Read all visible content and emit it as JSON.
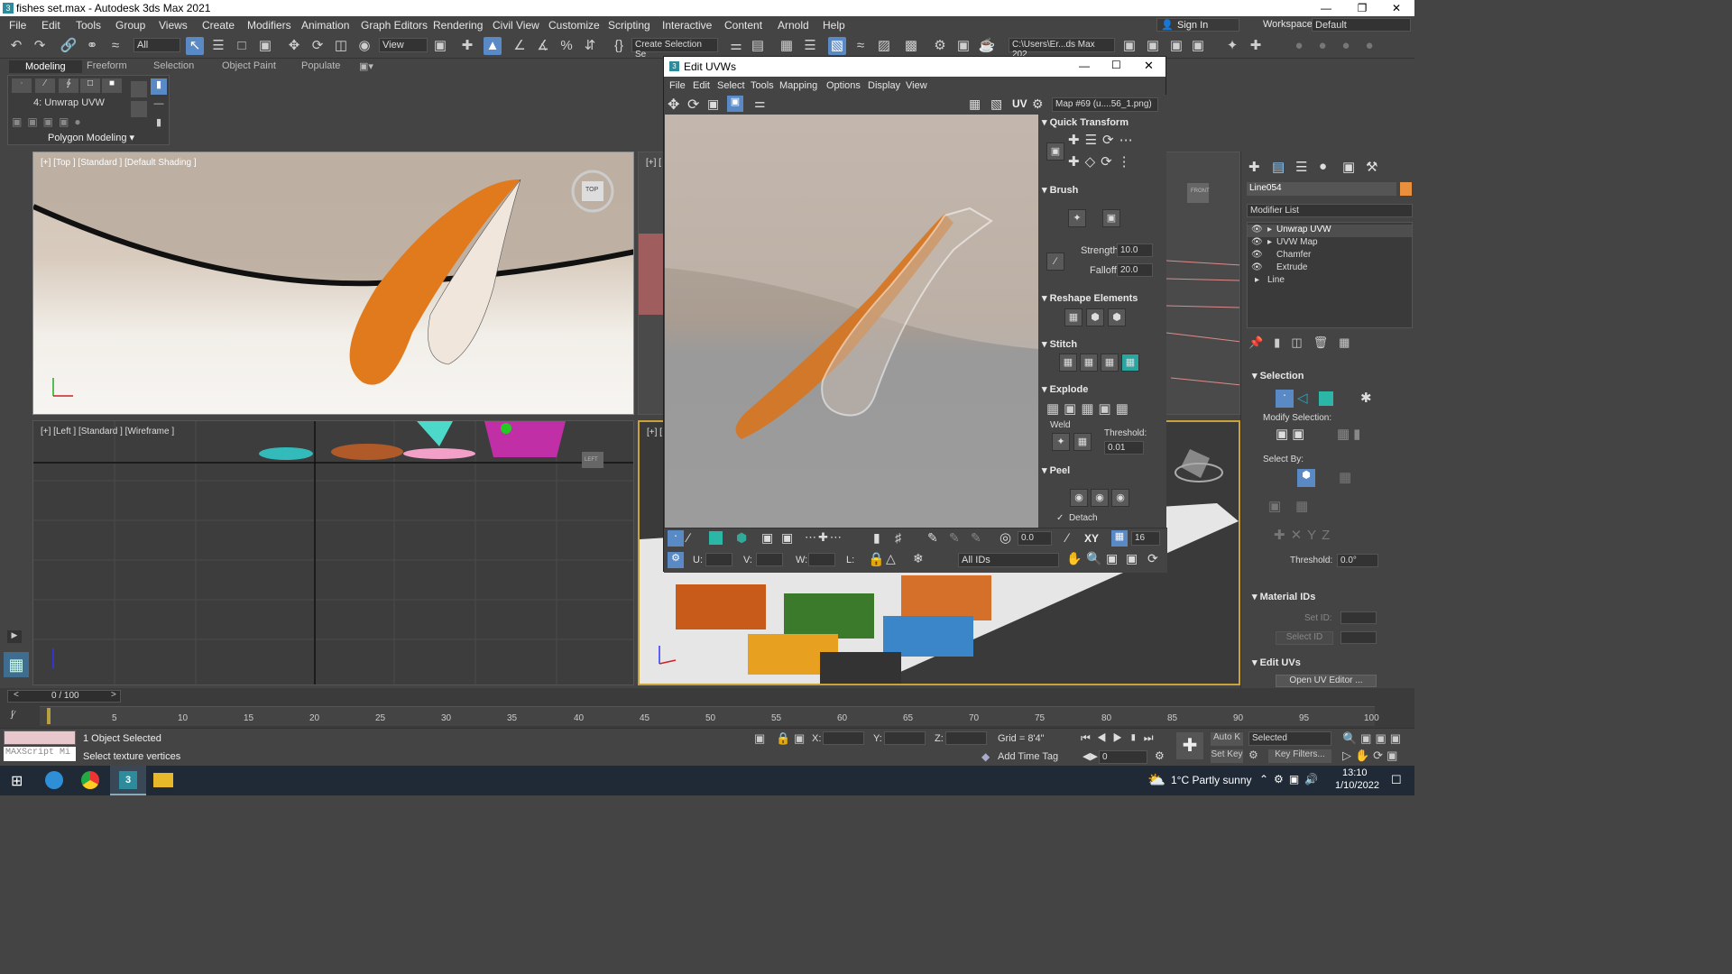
{
  "window": {
    "title": "fishes set.max - Autodesk 3ds Max 2021"
  },
  "menubar": [
    "File",
    "Edit",
    "Tools",
    "Group",
    "Views",
    "Create",
    "Modifiers",
    "Animation",
    "Graph Editors",
    "Rendering",
    "Civil View",
    "Customize",
    "Scripting",
    "Interactive",
    "Content",
    "Arnold",
    "Help"
  ],
  "account": {
    "signin": "Sign In",
    "workspaces_label": "Workspaces:",
    "workspace_value": "Default"
  },
  "toolbar": {
    "filter": "All",
    "view": "View",
    "selection_set": "Create Selection Se",
    "path": "C:\\Users\\Er...ds Max 202"
  },
  "ribbon": {
    "tabs": [
      "Modeling",
      "Freeform",
      "Selection",
      "Object Paint",
      "Populate"
    ],
    "stack_label": "4: Unwrap UVW",
    "polygon_modeling": "Polygon Modeling"
  },
  "viewports": {
    "top": "[+] [Top ] [Standard ] [Default Shading ]",
    "left": "[+] [Left ] [Standard ] [Wireframe ]",
    "tr": "[+] [",
    "br": "[+] [",
    "navcube_top": "TOP",
    "navcube_left": "LEFT",
    "navcube_front": "FRONT"
  },
  "uvw": {
    "title": "Edit UVWs",
    "menus": [
      "File",
      "Edit",
      "Select",
      "Tools",
      "Mapping",
      "Options",
      "Display",
      "View"
    ],
    "uv_label": "UV",
    "map": "Map #69 (u....56_1.png)",
    "sections": {
      "quick_transform": "Quick Transform",
      "brush": "Brush",
      "reshape": "Reshape Elements",
      "stitch": "Stitch",
      "explode": "Explode",
      "peel": "Peel"
    },
    "strength_label": "Strength:",
    "strength": "10.0",
    "falloff_label": "Falloff:",
    "falloff": "20.0",
    "weld_label": "Weld",
    "threshold_label": "Threshold:",
    "threshold": "0.01",
    "detach_label": "Detach",
    "bottom": {
      "spin1": "0.0",
      "xy": "XY",
      "spin2": "16",
      "u": "U:",
      "v": "V:",
      "w": "W:",
      "l": "L:",
      "ids": "All IDs"
    }
  },
  "cmdpanel": {
    "object_name": "Line054",
    "modifier_list": "Modifier List",
    "stack": [
      "Unwrap UVW",
      "UVW Map",
      "Chamfer",
      "Extrude",
      "Line"
    ],
    "selection": "Selection",
    "modify_selection": "Modify Selection:",
    "select_by": "Select By:",
    "threshold_label": "Threshold:",
    "threshold": "0.0°",
    "material_ids": "Material IDs",
    "set_id": "Set ID:",
    "select_id": "Select ID",
    "edit_uvs": "Edit UVs",
    "open_uv_editor": "Open UV Editor ..."
  },
  "timeline": {
    "frame": "0 / 100",
    "ticks": [
      "5",
      "10",
      "15",
      "20",
      "25",
      "30",
      "35",
      "40",
      "45",
      "50",
      "55",
      "60",
      "65",
      "70",
      "75",
      "80",
      "85",
      "90",
      "95",
      "100"
    ]
  },
  "status": {
    "maxscript": "MAXScript Mi",
    "selected": "1 Object Selected",
    "prompt": "Select texture vertices",
    "x": "X:",
    "y": "Y:",
    "z": "Z:",
    "grid": "Grid = 8'4\"",
    "add_time_tag": "Add Time Tag",
    "autokey": "Auto K",
    "selected_dd": "Selected",
    "setkey": "Set Key",
    "keyfilters": "Key Filters...",
    "frame_val": "0"
  },
  "taskbar": {
    "weather": "1°C  Partly sunny",
    "time": "13:10",
    "date": "1/10/2022"
  }
}
